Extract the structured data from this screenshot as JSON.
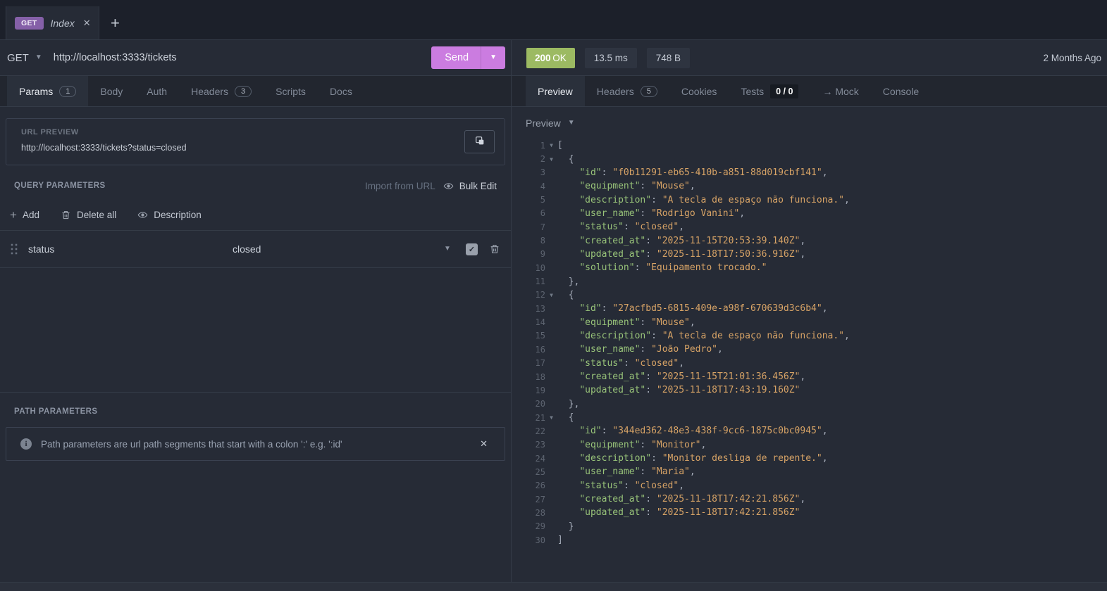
{
  "colors": {
    "accent_purple": "#8560a8",
    "send_button": "#cb7ce0",
    "status_green": "#9cba62",
    "json_key_green": "#98c379",
    "json_string_orange": "#d7a366"
  },
  "tab_strip": {
    "active_tab": {
      "method": "GET",
      "title": "Index",
      "close": "✕"
    },
    "new_tab_label": "+"
  },
  "request_bar": {
    "method": "GET",
    "url": "http://localhost:3333/tickets",
    "send_label": "Send"
  },
  "response_summary": {
    "status_code": "200",
    "status_text": "OK",
    "time": "13.5 ms",
    "size": "748 B",
    "age": "2 Months Ago"
  },
  "request_tabs": [
    {
      "label": "Params",
      "badge": "1",
      "active": true
    },
    {
      "label": "Body"
    },
    {
      "label": "Auth"
    },
    {
      "label": "Headers",
      "badge": "3"
    },
    {
      "label": "Scripts"
    },
    {
      "label": "Docs"
    }
  ],
  "response_tabs": [
    {
      "label": "Preview",
      "active": true
    },
    {
      "label": "Headers",
      "badge": "5"
    },
    {
      "label": "Cookies"
    },
    {
      "label": "Tests",
      "counter": "0 / 0"
    },
    {
      "label": "→ Mock"
    },
    {
      "label": "Console"
    }
  ],
  "url_preview": {
    "label": "URL PREVIEW",
    "url": "http://localhost:3333/tickets?status=closed"
  },
  "query_params": {
    "heading": "QUERY PARAMETERS",
    "import_from_url_label": "Import from URL",
    "bulk_edit_label": "Bulk Edit",
    "add_label": "Add",
    "delete_all_label": "Delete all",
    "description_label": "Description",
    "rows": [
      {
        "key": "status",
        "value": "closed",
        "enabled": true
      }
    ]
  },
  "path_params": {
    "heading": "PATH PARAMETERS",
    "info_text": "Path parameters are url path segments that start with a colon ':' e.g. ':id'"
  },
  "response_viewer": {
    "mode": "Preview",
    "body": [
      {
        "id": "f0b11291-eb65-410b-a851-88d019cbf141",
        "equipment": "Mouse",
        "description": "A tecla de espaço não funciona.",
        "user_name": "Rodrigo Vanini",
        "status": "closed",
        "created_at": "2025-11-15T20:53:39.140Z",
        "updated_at": "2025-11-18T17:50:36.916Z",
        "solution": "Equipamento trocado."
      },
      {
        "id": "27acfbd5-6815-409e-a98f-670639d3c6b4",
        "equipment": "Mouse",
        "description": "A tecla de espaço não funciona.",
        "user_name": "João Pedro",
        "status": "closed",
        "created_at": "2025-11-15T21:01:36.456Z",
        "updated_at": "2025-11-18T17:43:19.160Z"
      },
      {
        "id": "344ed362-48e3-438f-9cc6-1875c0bc0945",
        "equipment": "Monitor",
        "description": "Monitor desliga de repente.",
        "user_name": "Maria",
        "status": "closed",
        "created_at": "2025-11-18T17:42:21.856Z",
        "updated_at": "2025-11-18T17:42:21.856Z"
      }
    ]
  }
}
